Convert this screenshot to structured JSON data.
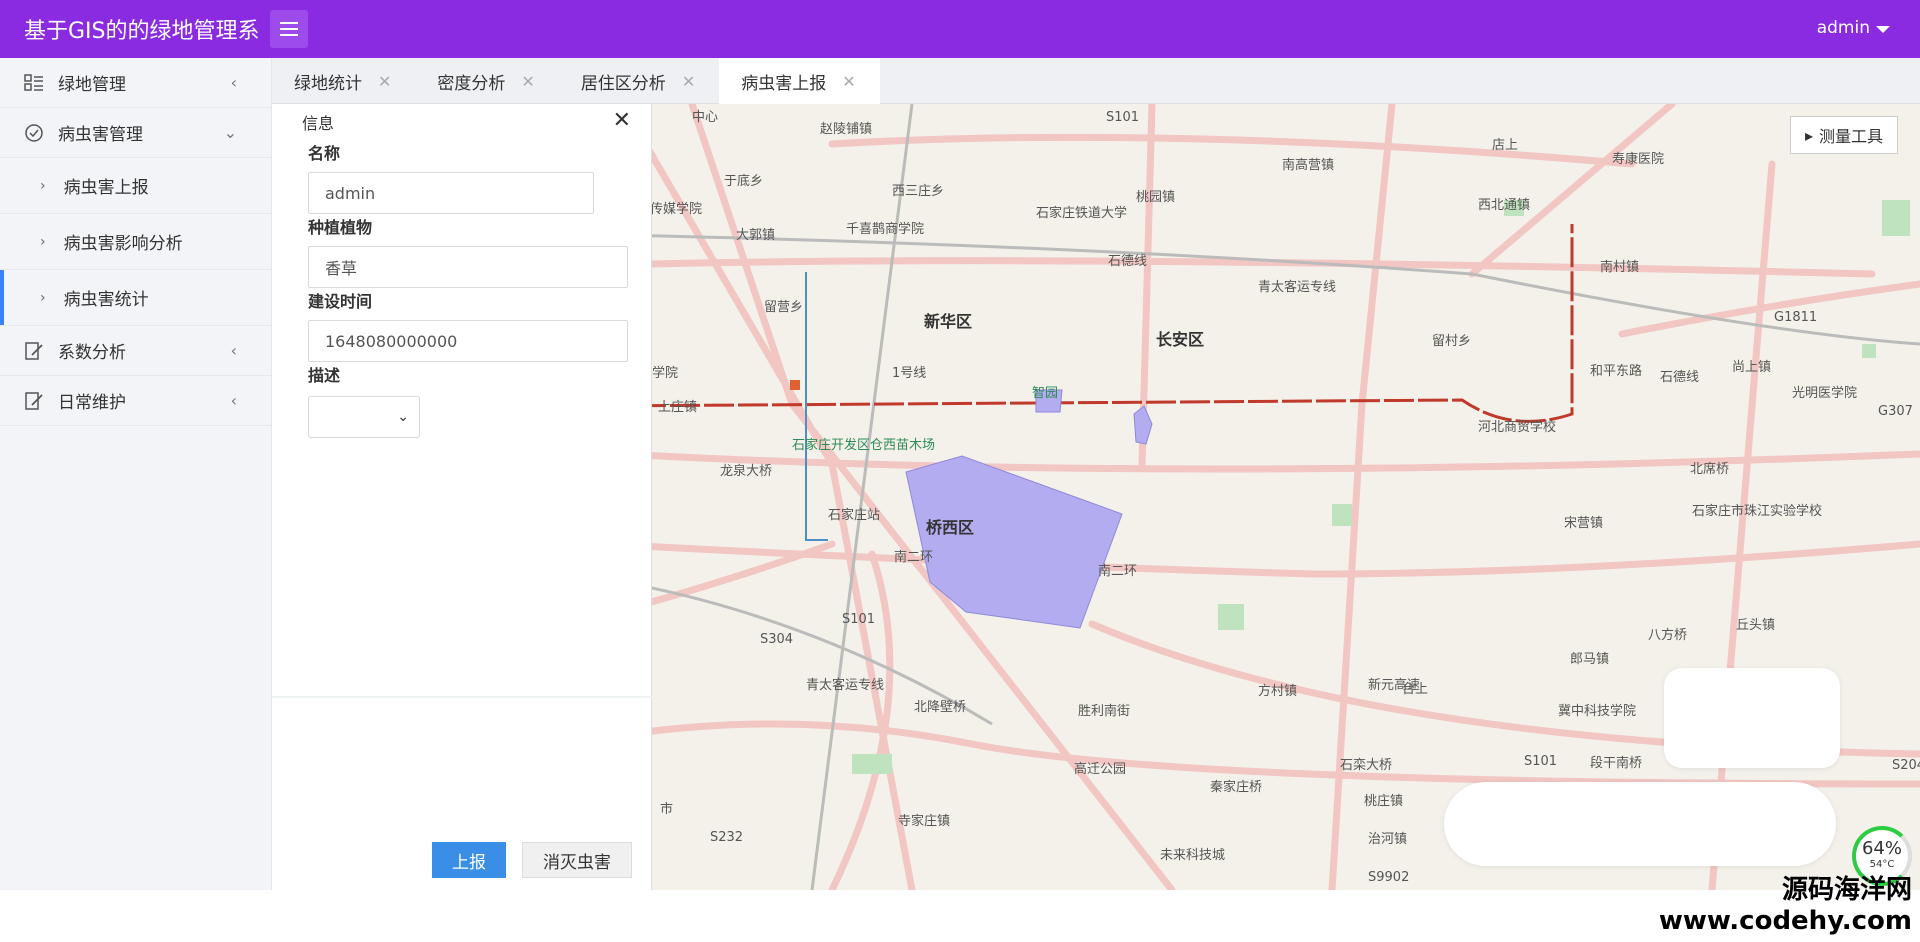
{
  "header": {
    "app_title": "基于GIS的的绿地管理系",
    "menu_toggle_icon": "hamburger-icon",
    "user": "admin"
  },
  "sidebar": {
    "items": [
      {
        "label": "绿地管理",
        "icon": "grid-list-icon",
        "arrow": "‹"
      },
      {
        "label": "病虫害管理",
        "icon": "check-circle-icon",
        "arrow": "⌄"
      },
      {
        "label": "病虫害上报",
        "chev": "›"
      },
      {
        "label": "病虫害影响分析",
        "chev": "›"
      },
      {
        "label": "病虫害统计",
        "chev": "›"
      },
      {
        "label": "系数分析",
        "icon": "edit-doc-icon",
        "arrow": "‹"
      },
      {
        "label": "日常维护",
        "icon": "edit-doc-icon",
        "arrow": "‹"
      }
    ]
  },
  "tabs": [
    {
      "label": "绿地统计"
    },
    {
      "label": "密度分析"
    },
    {
      "label": "居住区分析"
    },
    {
      "label": "病虫害上报"
    }
  ],
  "tab_close": "✕",
  "panel": {
    "title": "信息",
    "close": "✕",
    "fields": {
      "name_label": "名称",
      "name_value": "admin",
      "plant_label": "种植植物",
      "plant_value": "香草",
      "time_label": "建设时间",
      "time_value": "1648080000000",
      "desc_label": "描述"
    },
    "report_button": "上报",
    "kill_button": "消灭虫害"
  },
  "map": {
    "measure_tool": "测量工具",
    "labels": [
      "中心",
      "赵陵铺镇",
      "S101",
      "南高营镇",
      "店上",
      "寿康医院",
      "于底乡",
      "西三庄乡",
      "桃园镇",
      "西北通镇",
      "传媒学院",
      "大郭镇",
      "千喜鹊商学院",
      "石家庄铁道大学",
      "石德线",
      "南村镇",
      "留营乡",
      "新华区",
      "长安区",
      "青太客运专线",
      "留村乡",
      "G1811",
      "学院",
      "上庄镇",
      "1号线",
      "智园",
      "和平东路",
      "石德线",
      "尚上镇",
      "光明医学院",
      "河北商贸学校",
      "G307",
      "石家庄开发区仓西苗木场",
      "龙泉大桥",
      "北席桥",
      "石家庄站",
      "桥西区",
      "宋营镇",
      "石家庄市珠江实验学校",
      "南二环",
      "南二环",
      "S101",
      "S304",
      "八方桥",
      "丘头镇",
      "郎马镇",
      "方村镇",
      "台上",
      "新元高速",
      "青太客运专线",
      "北降壁桥",
      "胜利南街",
      "冀中科技学院",
      "高迁公园",
      "秦家庄桥",
      "石栾大桥",
      "S101",
      "段干南桥",
      "S204",
      "寺家庄镇",
      "桃庄镇",
      "治河镇",
      "未来科技城",
      "S232",
      "S9902",
      "市"
    ]
  },
  "gauge": {
    "value": "64%",
    "temp": "54°C"
  },
  "watermark": {
    "line1": "源码海洋网",
    "line2": "www.codehy.com"
  }
}
